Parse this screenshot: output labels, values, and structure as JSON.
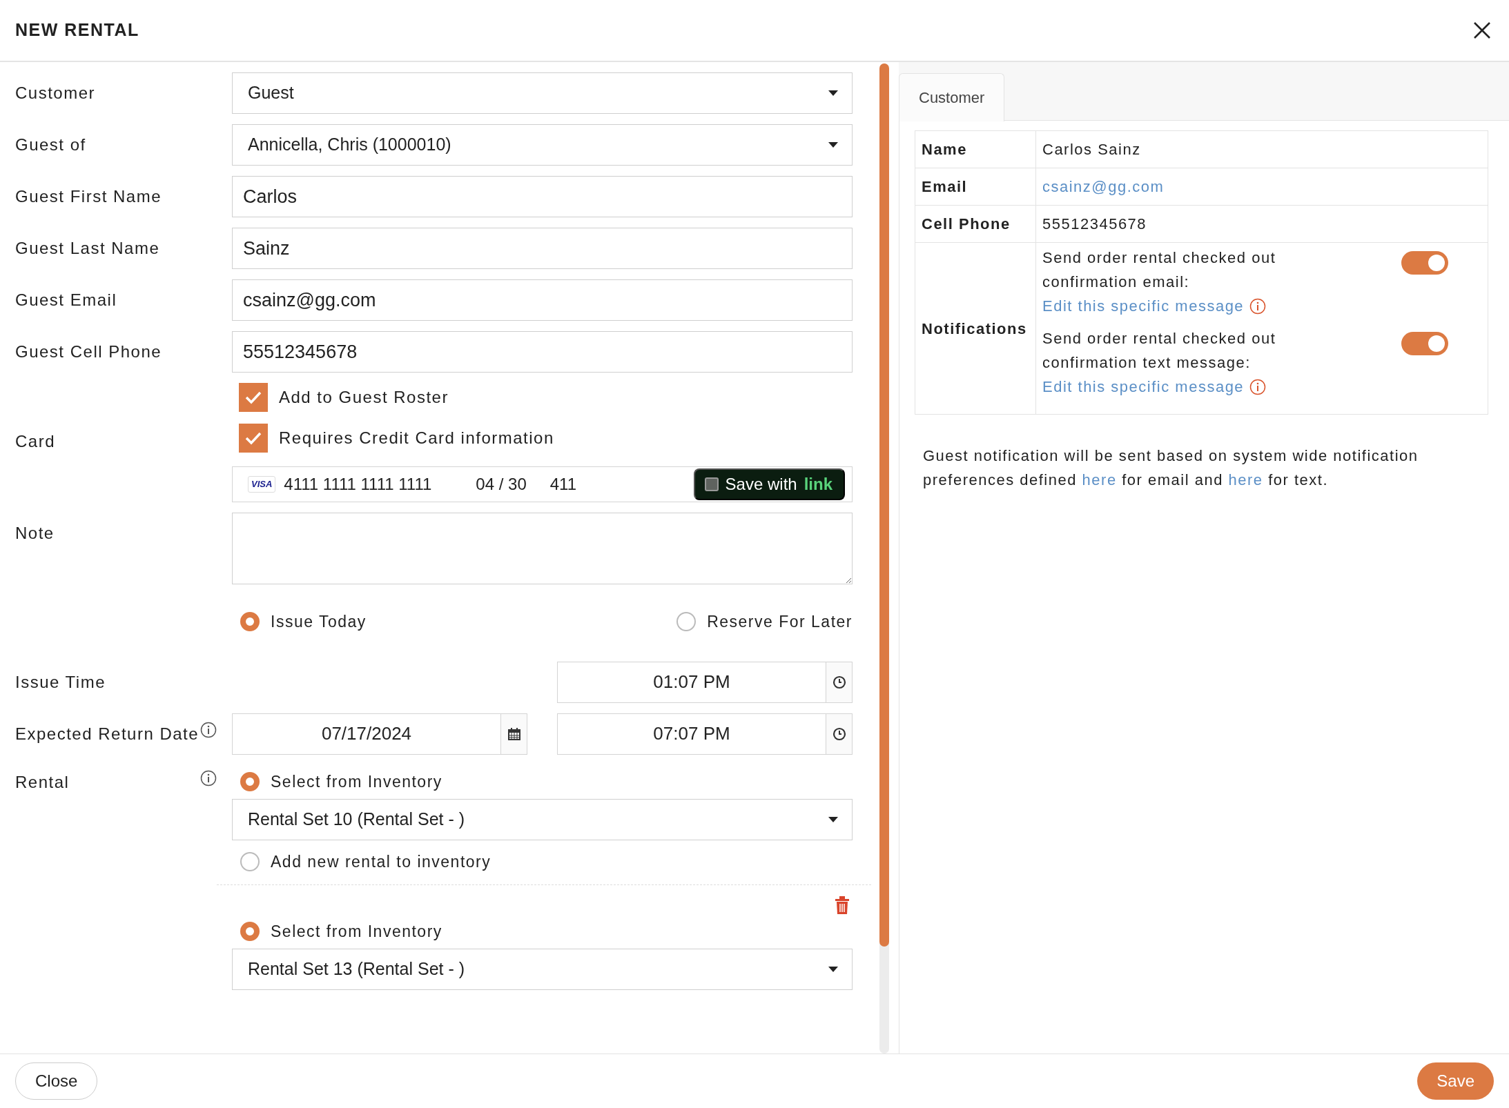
{
  "title": "NEW RENTAL",
  "form": [
    {
      "kind": "select",
      "label": "Customer",
      "value": "Guest"
    },
    {
      "kind": "select",
      "label": "Guest of",
      "value": "Annicella, Chris (1000010)"
    },
    {
      "kind": "text",
      "label": "Guest First Name",
      "value": "Carlos"
    },
    {
      "kind": "text",
      "label": "Guest Last Name",
      "value": "Sainz"
    },
    {
      "kind": "text",
      "label": "Guest Email",
      "value": "csainz@gg.com"
    },
    {
      "kind": "text",
      "label": "Guest Cell Phone",
      "value": "55512345678"
    },
    {
      "kind": "checkbox",
      "text": "Add to Guest Roster",
      "checked": true
    },
    {
      "kind": "card",
      "label": "Card",
      "checkbox": {
        "text": "Requires Credit Card information",
        "checked": true
      },
      "brand": "VISA",
      "number": "4111 1111 1111 1111",
      "expiry": "04 / 30",
      "cvc": "411",
      "save_text": "Save with",
      "save_brand": "link",
      "save_checked": false
    },
    {
      "kind": "textarea",
      "label": "Note"
    },
    {
      "kind": "radios",
      "options": [
        {
          "label": "Issue Today",
          "selected": true
        },
        {
          "label": "Reserve For Later",
          "selected": false
        }
      ]
    },
    {
      "kind": "time",
      "label": "Issue Time",
      "time": "01:07 PM"
    },
    {
      "kind": "datetime",
      "label": "Expected Return Date",
      "info": true,
      "date": "07/17/2024",
      "time": "07:07 PM"
    },
    {
      "kind": "rental",
      "label": "Rental",
      "info": true,
      "deletable": false,
      "options": [
        {
          "label": "Select from Inventory",
          "selected": true
        }
      ],
      "value": "Rental Set 10 (Rental Set - )",
      "after": [
        {
          "label": "Add new rental to inventory",
          "selected": false
        }
      ]
    },
    {
      "kind": "rental",
      "deletable": true,
      "options": [
        {
          "label": "Select from Inventory",
          "selected": true
        }
      ],
      "value": "Rental Set 13 (Rental Set - )"
    }
  ],
  "side": {
    "tabs": [
      {
        "label": "Customer",
        "selected": true
      }
    ],
    "rows": [
      {
        "label": "Name",
        "value": "Carlos Sainz",
        "kind": "text"
      },
      {
        "label": "Email",
        "value": "csainz@gg.com",
        "kind": "link"
      },
      {
        "label": "Cell Phone",
        "value": "55512345678",
        "kind": "text"
      }
    ],
    "notifications": {
      "label": "Notifications",
      "items": [
        {
          "text": "Send order rental checked out confirmation email:",
          "link": "Edit this specific message",
          "on": true
        },
        {
          "text": "Send order rental checked out confirmation text message:",
          "link": "Edit this specific message",
          "on": true
        }
      ]
    },
    "note": [
      {
        "kind": "text",
        "text": "Guest notification will be sent based on system wide notification preferences defined "
      },
      {
        "kind": "link",
        "text": "here"
      },
      {
        "kind": "text",
        "text": " for email and "
      },
      {
        "kind": "link",
        "text": "here"
      },
      {
        "kind": "text",
        "text": " for text."
      }
    ]
  },
  "footer": {
    "close": "Close",
    "save": "Save"
  }
}
